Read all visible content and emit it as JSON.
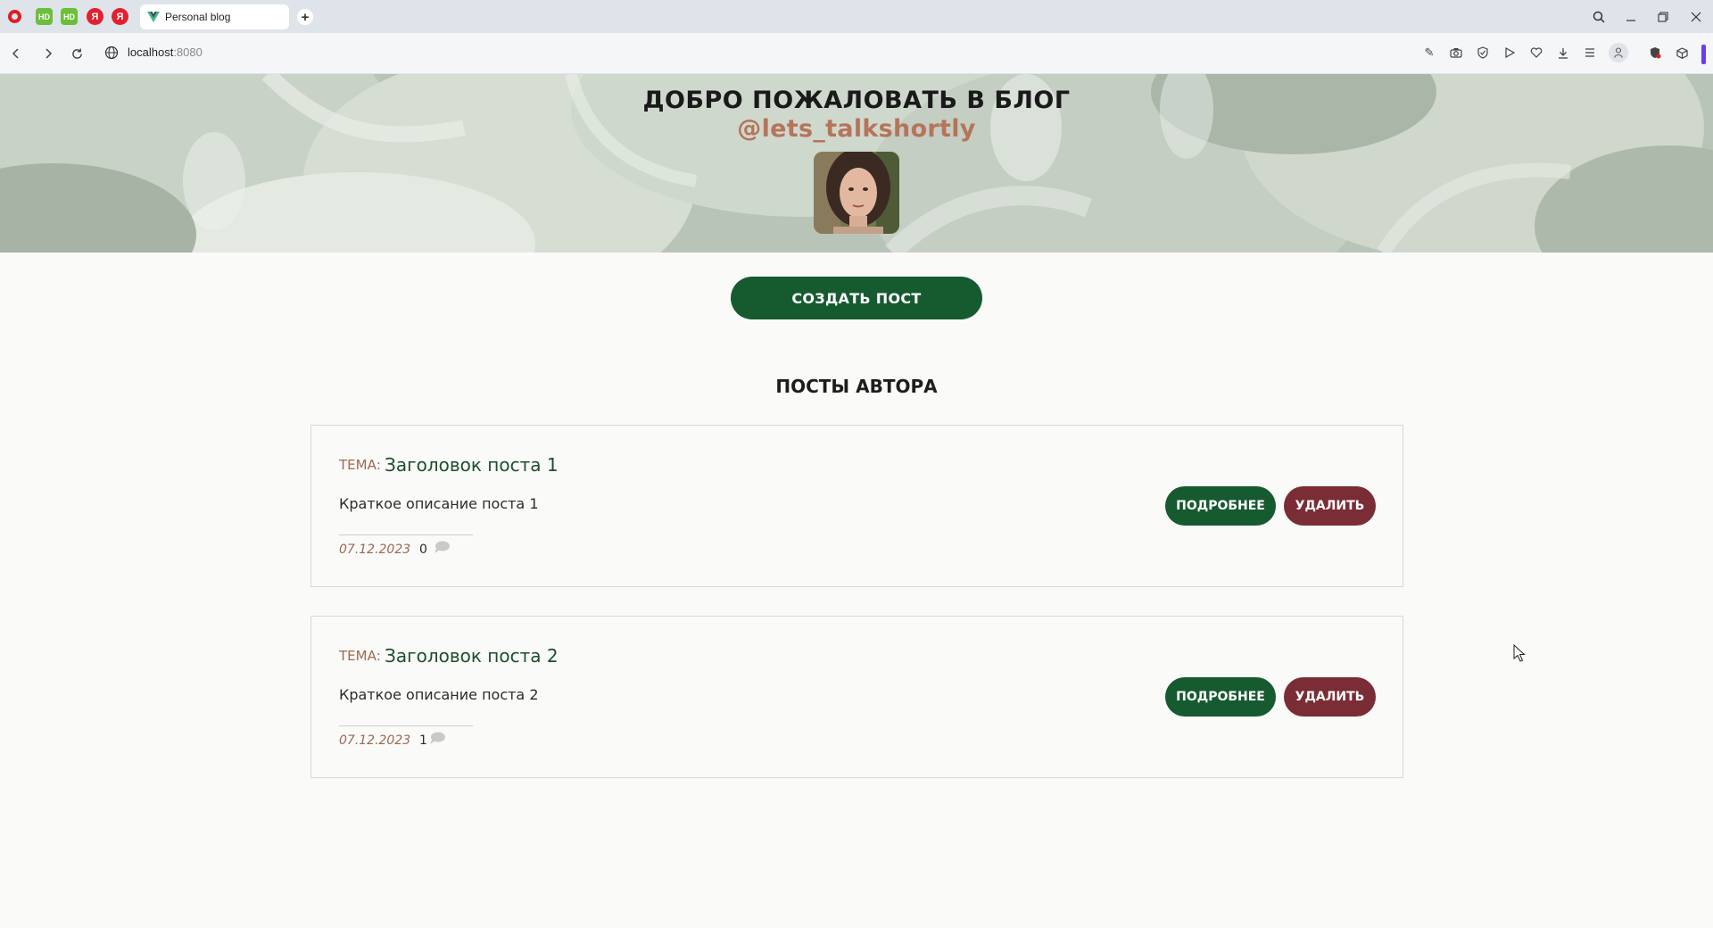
{
  "browser": {
    "tab_title": "Personal blog",
    "url_host": "localhost",
    "url_port": ":8080",
    "pinned": [
      {
        "name": "opera-icon",
        "label": ""
      },
      {
        "name": "hd-icon",
        "label": "HD"
      },
      {
        "name": "hd-icon",
        "label": "HD"
      },
      {
        "name": "yandex-icon",
        "label": "Я"
      },
      {
        "name": "yandex-icon",
        "label": "Я"
      }
    ]
  },
  "hero": {
    "title": "ДОБРО ПОЖАЛОВАТЬ В БЛОГ",
    "handle": "@lets_talkshortly"
  },
  "actions": {
    "create_post": "СОЗДАТЬ ПОСТ"
  },
  "posts_section": {
    "heading": "ПОСТЫ АВТОРА"
  },
  "posts": [
    {
      "topic_label": "ТЕМА:",
      "title": "Заголовок поста 1",
      "description": "Краткое описание поста 1",
      "date": "07.12.2023",
      "comments": "0",
      "more_label": "ПОДРОБНЕЕ",
      "delete_label": "УДАЛИТЬ"
    },
    {
      "topic_label": "ТЕМА:",
      "title": "Заголовок поста 2",
      "description": "Краткое описание поста 2",
      "date": "07.12.2023",
      "comments": "1",
      "more_label": "ПОДРОБНЕЕ",
      "delete_label": "УДАЛИТЬ"
    }
  ],
  "colors": {
    "primary_green": "#165a30",
    "delete_red": "#7a2d35",
    "accent_brown": "#b6745a"
  }
}
